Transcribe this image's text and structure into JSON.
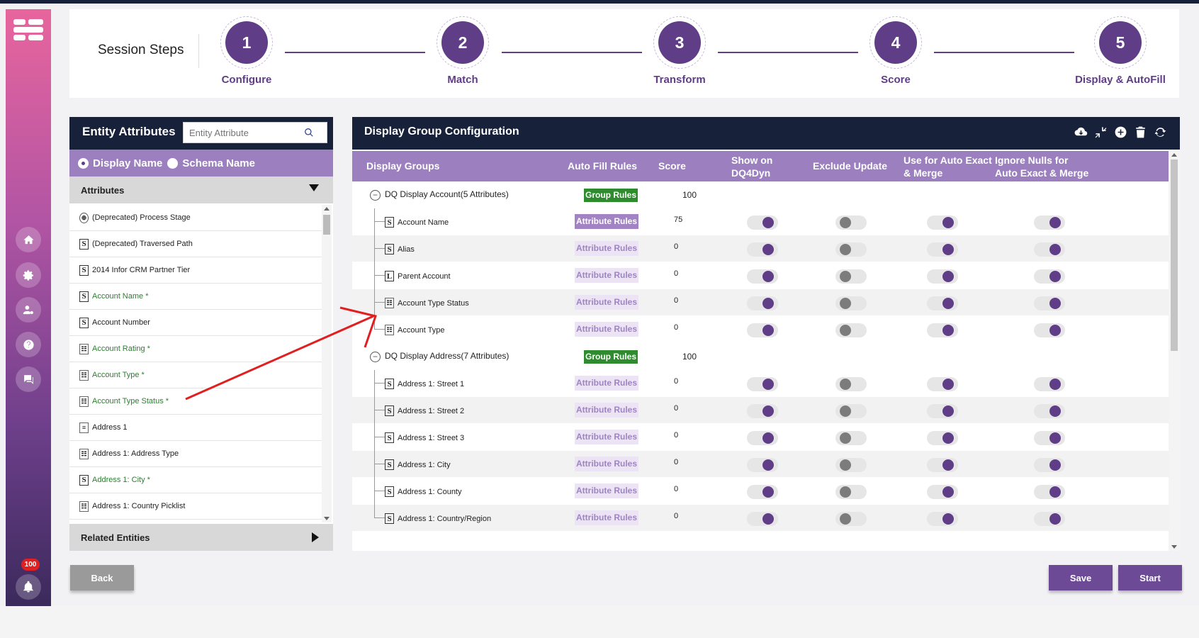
{
  "sidebar": {
    "notification_count": "100"
  },
  "steps": {
    "title": "Session Steps",
    "items": [
      {
        "number": "1",
        "label": "Configure"
      },
      {
        "number": "2",
        "label": "Match"
      },
      {
        "number": "3",
        "label": "Transform"
      },
      {
        "number": "4",
        "label": "Score"
      },
      {
        "number": "5",
        "label": "Display & AutoFill"
      }
    ]
  },
  "entity_attributes": {
    "title": "Entity Attributes",
    "search_placeholder": "Entity Attribute",
    "radio_display": "Display Name",
    "radio_schema": "Schema Name",
    "selected_radio": "Display Name",
    "attributes_header": "Attributes",
    "related_header": "Related Entities",
    "items": [
      {
        "label": "(Deprecated) Process Stage",
        "icon": "globe-icon",
        "glyph": "⊕",
        "required": false
      },
      {
        "label": "(Deprecated) Traversed Path",
        "icon": "string-icon",
        "glyph": "S",
        "required": false
      },
      {
        "label": "2014 Infor CRM Partner Tier",
        "icon": "string-icon",
        "glyph": "S",
        "required": false
      },
      {
        "label": "Account Name *",
        "icon": "string-icon",
        "glyph": "S",
        "required": true
      },
      {
        "label": "Account Number",
        "icon": "string-icon",
        "glyph": "S",
        "required": false
      },
      {
        "label": "Account Rating *",
        "icon": "picklist-icon",
        "glyph": "☷",
        "required": true
      },
      {
        "label": "Account Type *",
        "icon": "picklist-icon",
        "glyph": "☷",
        "required": true
      },
      {
        "label": "Account Type Status *",
        "icon": "picklist-icon",
        "glyph": "☷",
        "required": true
      },
      {
        "label": "Address 1",
        "icon": "text-icon",
        "glyph": "≡",
        "required": false
      },
      {
        "label": "Address 1: Address Type",
        "icon": "picklist-icon",
        "glyph": "☷",
        "required": false
      },
      {
        "label": "Address 1: City *",
        "icon": "string-icon",
        "glyph": "S",
        "required": true
      },
      {
        "label": "Address 1: Country Picklist",
        "icon": "picklist-icon",
        "glyph": "☷",
        "required": false
      }
    ]
  },
  "display_group_config": {
    "title": "Display Group Configuration",
    "toolbar_icons": [
      "cloud-download-icon",
      "collapse-icon",
      "add-circle-icon",
      "trash-icon",
      "refresh-icon"
    ],
    "columns": [
      "Display Groups",
      "Auto Fill Rules",
      "Score",
      "Show on DQ4Dyn",
      "Exclude Update",
      "Use for Auto Exact & Merge",
      "Ignore Nulls for Auto Exact & Merge"
    ],
    "group_rules_label": "Group Rules",
    "attribute_rules_label": "Attribute Rules",
    "groups": [
      {
        "name": "DQ Display Account(5 Attributes)",
        "score": "100",
        "attributes": [
          {
            "name": "Account Name",
            "icon": "string-icon",
            "glyph": "S",
            "score": "75",
            "rules_active": true,
            "show": true,
            "exclude": false,
            "exact": true,
            "ignore_nulls": true
          },
          {
            "name": "Alias",
            "icon": "string-icon",
            "glyph": "S",
            "score": "0",
            "rules_active": false,
            "show": true,
            "exclude": false,
            "exact": true,
            "ignore_nulls": true
          },
          {
            "name": "Parent Account",
            "icon": "lookup-icon",
            "glyph": "L",
            "score": "0",
            "rules_active": false,
            "show": true,
            "exclude": false,
            "exact": true,
            "ignore_nulls": true
          },
          {
            "name": "Account Type Status",
            "icon": "picklist-icon",
            "glyph": "☷",
            "score": "0",
            "rules_active": false,
            "show": true,
            "exclude": false,
            "exact": true,
            "ignore_nulls": true
          },
          {
            "name": "Account Type",
            "icon": "picklist-icon",
            "glyph": "☷",
            "score": "0",
            "rules_active": false,
            "show": true,
            "exclude": false,
            "exact": true,
            "ignore_nulls": true
          }
        ]
      },
      {
        "name": "DQ Display Address(7 Attributes)",
        "score": "100",
        "attributes": [
          {
            "name": "Address 1: Street 1",
            "icon": "string-icon",
            "glyph": "S",
            "score": "0",
            "rules_active": false,
            "show": true,
            "exclude": false,
            "exact": true,
            "ignore_nulls": true
          },
          {
            "name": "Address 1: Street 2",
            "icon": "string-icon",
            "glyph": "S",
            "score": "0",
            "rules_active": false,
            "show": true,
            "exclude": false,
            "exact": true,
            "ignore_nulls": true
          },
          {
            "name": "Address 1: Street 3",
            "icon": "string-icon",
            "glyph": "S",
            "score": "0",
            "rules_active": false,
            "show": true,
            "exclude": false,
            "exact": true,
            "ignore_nulls": true
          },
          {
            "name": "Address 1: City",
            "icon": "string-icon",
            "glyph": "S",
            "score": "0",
            "rules_active": false,
            "show": true,
            "exclude": false,
            "exact": true,
            "ignore_nulls": true
          },
          {
            "name": "Address 1: County",
            "icon": "string-icon",
            "glyph": "S",
            "score": "0",
            "rules_active": false,
            "show": true,
            "exclude": false,
            "exact": true,
            "ignore_nulls": true
          },
          {
            "name": "Address 1: Country/Region",
            "icon": "string-icon",
            "glyph": "S",
            "score": "0",
            "rules_active": false,
            "show": true,
            "exclude": false,
            "exact": true,
            "ignore_nulls": true
          }
        ]
      }
    ]
  },
  "buttons": {
    "back": "Back",
    "save": "Save",
    "start": "Start"
  },
  "colors": {
    "primary": "#5f3d87",
    "header_bg": "#18213a",
    "subheader": "#9b7fbf",
    "group_rules": "#2e8b2e",
    "annotation_arrow": "#e02020"
  }
}
